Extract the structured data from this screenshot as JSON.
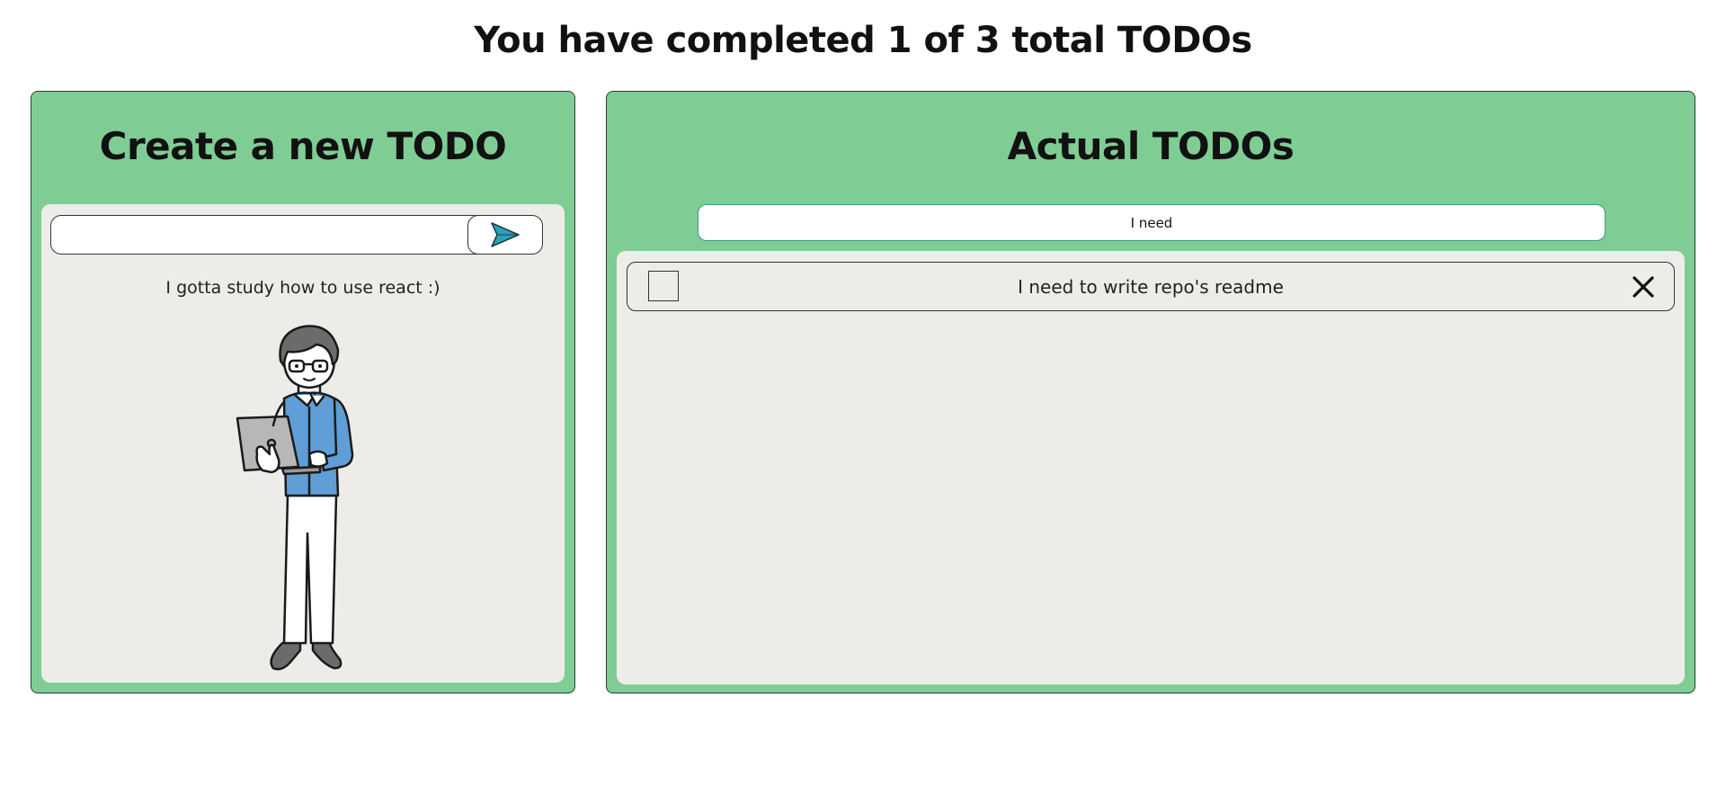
{
  "header": {
    "title": "You have completed 1 of 3 total TODOs"
  },
  "create_panel": {
    "title": "Create a new TODO",
    "input_value": "",
    "send_icon": "send-arrow-icon",
    "hint_text": "I gotta study how to use react :)",
    "illustration": "person-with-laptop"
  },
  "todos_panel": {
    "title": "Actual TODOs",
    "search_value": "I need",
    "items": [
      {
        "text": "I need to write repo's readme",
        "completed": false,
        "delete_icon": "close-icon"
      }
    ]
  },
  "colors": {
    "panel_bg": "#7fcd94",
    "inner_bg": "#eeece8",
    "send_icon_fill": "#2aa3b8",
    "search_border": "#3a9a8a"
  }
}
